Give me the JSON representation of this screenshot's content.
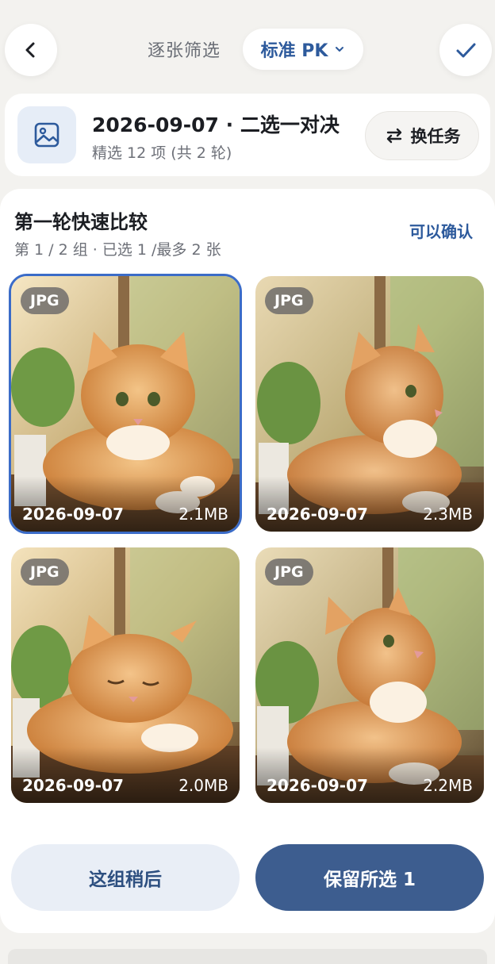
{
  "header": {
    "mode_label": "逐张筛选",
    "mode_select": "标准 PK"
  },
  "task": {
    "title": "2026-09-07 · 二选一对决",
    "subtitle": "精选 12 项 (共 2 轮)",
    "switch_label": "换任务"
  },
  "round": {
    "title": "第一轮快速比较",
    "subtitle": "第 1 / 2 组 · 已选 1 /最多 2 张",
    "status": "可以确认"
  },
  "photos": [
    {
      "format": "JPG",
      "date": "2026-09-07",
      "size": "2.1MB",
      "selected": true
    },
    {
      "format": "JPG",
      "date": "2026-09-07",
      "size": "2.3MB",
      "selected": false
    },
    {
      "format": "JPG",
      "date": "2026-09-07",
      "size": "2.0MB",
      "selected": false
    },
    {
      "format": "JPG",
      "date": "2026-09-07",
      "size": "2.2MB",
      "selected": false
    }
  ],
  "actions": {
    "later": "这组稍后",
    "keep": "保留所选 1"
  },
  "icons": {
    "back": "chevron-left-icon",
    "confirm": "check-icon",
    "dropdown": "chevron-down-icon",
    "task": "image-icon",
    "switch": "swap-arrows-icon"
  },
  "colors": {
    "accent": "#2d5a9c",
    "selected_outline": "#3b6cc8",
    "primary_button": "#3d5d8f",
    "secondary_button": "#e9eef6"
  }
}
